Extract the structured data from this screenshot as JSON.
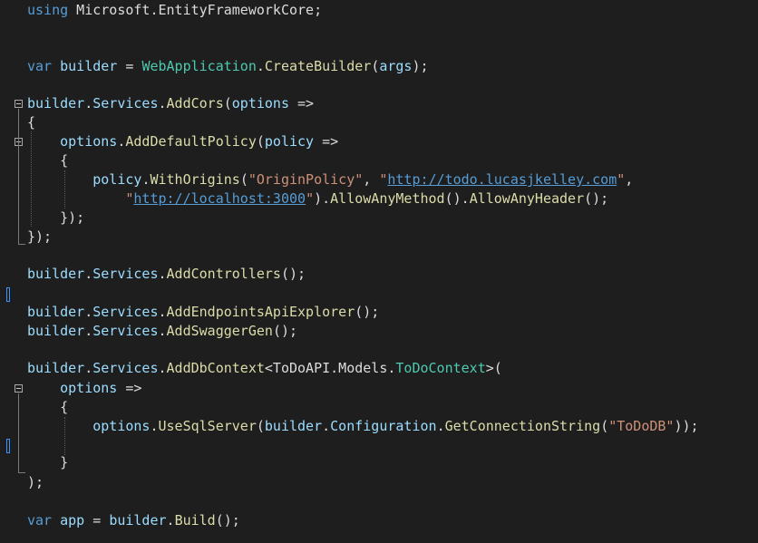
{
  "editor": {
    "lines": [
      [
        {
          "c": "k",
          "t": "using"
        },
        {
          "c": "w",
          "t": " Microsoft.EntityFrameworkCore;"
        }
      ],
      [
        {
          "c": "k",
          "t": "var"
        },
        {
          "c": "w",
          "t": " "
        },
        {
          "c": "v",
          "t": "builder"
        },
        {
          "c": "w",
          "t": " = "
        },
        {
          "c": "t",
          "t": "WebApplication"
        },
        {
          "c": "w",
          "t": "."
        },
        {
          "c": "m",
          "t": "CreateBuilder"
        },
        {
          "c": "w",
          "t": "("
        },
        {
          "c": "v",
          "t": "args"
        },
        {
          "c": "w",
          "t": ");"
        }
      ],
      [
        {
          "c": "v",
          "t": "builder"
        },
        {
          "c": "w",
          "t": "."
        },
        {
          "c": "v",
          "t": "Services"
        },
        {
          "c": "w",
          "t": "."
        },
        {
          "c": "m",
          "t": "AddCors"
        },
        {
          "c": "w",
          "t": "("
        },
        {
          "c": "v",
          "t": "options"
        },
        {
          "c": "w",
          "t": " =>"
        }
      ],
      [
        {
          "c": "w",
          "t": "{"
        }
      ],
      [
        {
          "c": "w",
          "t": "    "
        },
        {
          "c": "v",
          "t": "options"
        },
        {
          "c": "w",
          "t": "."
        },
        {
          "c": "m",
          "t": "AddDefaultPolicy"
        },
        {
          "c": "w",
          "t": "("
        },
        {
          "c": "v",
          "t": "policy"
        },
        {
          "c": "w",
          "t": " =>"
        }
      ],
      [
        {
          "c": "w",
          "t": "    {"
        }
      ],
      [
        {
          "c": "w",
          "t": "        "
        },
        {
          "c": "v",
          "t": "policy"
        },
        {
          "c": "w",
          "t": "."
        },
        {
          "c": "m",
          "t": "WithOrigins"
        },
        {
          "c": "w",
          "t": "("
        },
        {
          "c": "s",
          "t": "\"OriginPolicy\""
        },
        {
          "c": "w",
          "t": ", "
        },
        {
          "c": "s",
          "t": "\""
        },
        {
          "c": "u",
          "t": "http://todo.lucasjkelley.com"
        },
        {
          "c": "s",
          "t": "\""
        },
        {
          "c": "w",
          "t": ","
        }
      ],
      [
        {
          "c": "w",
          "t": "            "
        },
        {
          "c": "s",
          "t": "\""
        },
        {
          "c": "u",
          "t": "http://localhost:3000"
        },
        {
          "c": "s",
          "t": "\""
        },
        {
          "c": "w",
          "t": ")."
        },
        {
          "c": "m",
          "t": "AllowAnyMethod"
        },
        {
          "c": "w",
          "t": "()."
        },
        {
          "c": "m",
          "t": "AllowAnyHeader"
        },
        {
          "c": "w",
          "t": "();"
        }
      ],
      [
        {
          "c": "w",
          "t": "    });"
        }
      ],
      [
        {
          "c": "w",
          "t": "});"
        }
      ],
      [
        {
          "c": "v",
          "t": "builder"
        },
        {
          "c": "w",
          "t": "."
        },
        {
          "c": "v",
          "t": "Services"
        },
        {
          "c": "w",
          "t": "."
        },
        {
          "c": "m",
          "t": "AddControllers"
        },
        {
          "c": "w",
          "t": "();"
        }
      ],
      [
        {
          "c": "v",
          "t": "builder"
        },
        {
          "c": "w",
          "t": "."
        },
        {
          "c": "v",
          "t": "Services"
        },
        {
          "c": "w",
          "t": "."
        },
        {
          "c": "m",
          "t": "AddEndpointsApiExplorer"
        },
        {
          "c": "w",
          "t": "();"
        }
      ],
      [
        {
          "c": "v",
          "t": "builder"
        },
        {
          "c": "w",
          "t": "."
        },
        {
          "c": "v",
          "t": "Services"
        },
        {
          "c": "w",
          "t": "."
        },
        {
          "c": "m",
          "t": "AddSwaggerGen"
        },
        {
          "c": "w",
          "t": "();"
        }
      ],
      [
        {
          "c": "v",
          "t": "builder"
        },
        {
          "c": "w",
          "t": "."
        },
        {
          "c": "v",
          "t": "Services"
        },
        {
          "c": "w",
          "t": "."
        },
        {
          "c": "m",
          "t": "AddDbContext"
        },
        {
          "c": "w",
          "t": "<ToDoAPI.Models."
        },
        {
          "c": "t",
          "t": "ToDoContext"
        },
        {
          "c": "w",
          "t": ">("
        }
      ],
      [
        {
          "c": "w",
          "t": "    "
        },
        {
          "c": "v",
          "t": "options"
        },
        {
          "c": "w",
          "t": " =>"
        }
      ],
      [
        {
          "c": "w",
          "t": "    {"
        }
      ],
      [
        {
          "c": "w",
          "t": "        "
        },
        {
          "c": "v",
          "t": "options"
        },
        {
          "c": "w",
          "t": "."
        },
        {
          "c": "m",
          "t": "UseSqlServer"
        },
        {
          "c": "w",
          "t": "("
        },
        {
          "c": "v",
          "t": "builder"
        },
        {
          "c": "w",
          "t": "."
        },
        {
          "c": "v",
          "t": "Configuration"
        },
        {
          "c": "w",
          "t": "."
        },
        {
          "c": "m",
          "t": "GetConnectionString"
        },
        {
          "c": "w",
          "t": "("
        },
        {
          "c": "s",
          "t": "\"ToDoDB\""
        },
        {
          "c": "w",
          "t": "));"
        }
      ],
      [
        {
          "c": "w",
          "t": "    }"
        }
      ],
      [
        {
          "c": "w",
          "t": ");"
        }
      ],
      [
        {
          "c": "k",
          "t": "var"
        },
        {
          "c": "w",
          "t": " "
        },
        {
          "c": "v",
          "t": "app"
        },
        {
          "c": "w",
          "t": " = "
        },
        {
          "c": "v",
          "t": "builder"
        },
        {
          "c": "w",
          "t": "."
        },
        {
          "c": "m",
          "t": "Build"
        },
        {
          "c": "w",
          "t": "();"
        }
      ]
    ]
  },
  "colors": {
    "background": "#1e1e1e",
    "keyword": "#569cd6",
    "variable": "#9cdcfe",
    "type": "#4ec9b0",
    "method": "#dcdcaa",
    "string": "#ce9178",
    "plain": "#dcdcdc"
  }
}
